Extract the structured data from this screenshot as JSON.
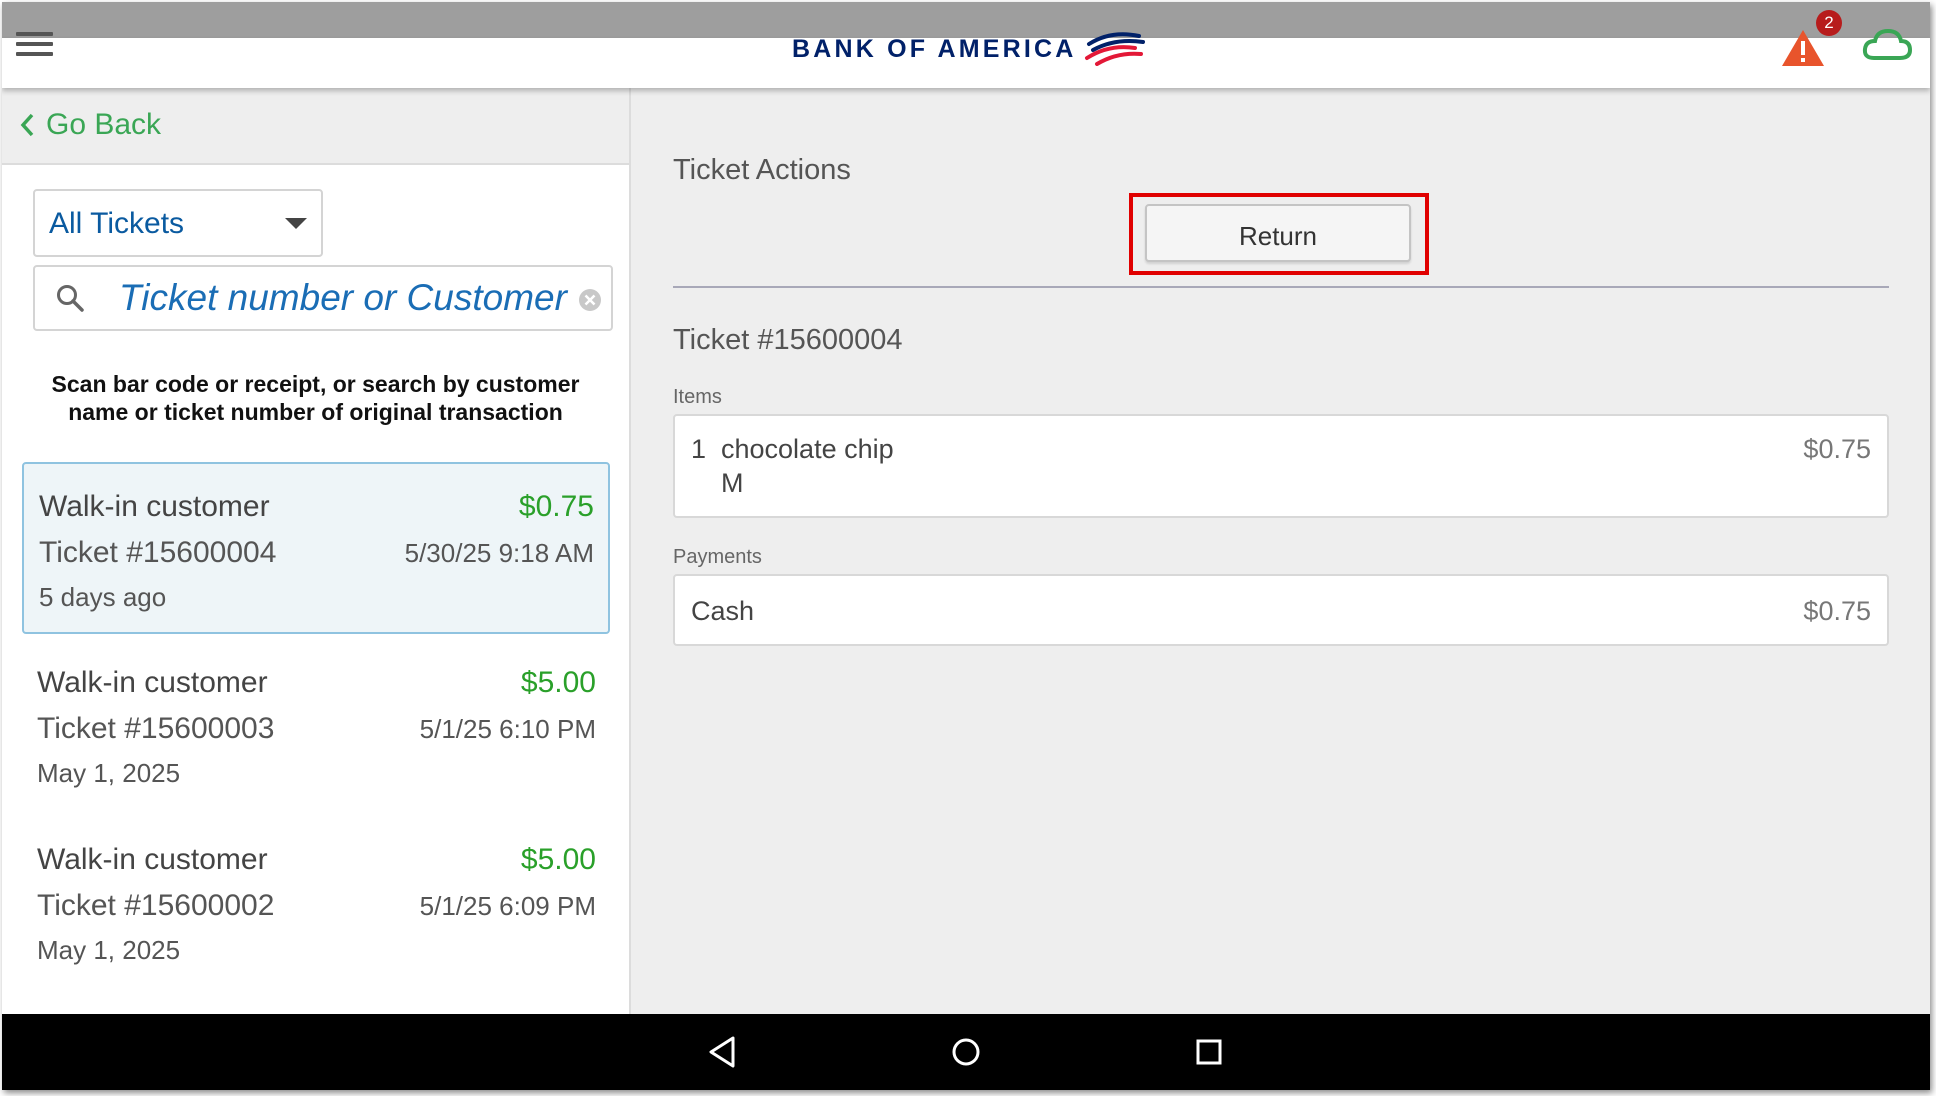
{
  "header": {
    "logo_text": "BANK OF AMERICA",
    "alert_count": "2",
    "brand_color": "#012169",
    "icons": [
      "menu-icon",
      "warning-icon",
      "cloud-icon"
    ]
  },
  "sidebar": {
    "go_back": "Go Back",
    "filter": "All Tickets",
    "search_placeholder": "Ticket number or Customer",
    "hint": "Scan bar code or receipt, or search by customer name or ticket number of original transaction",
    "tickets": [
      {
        "customer": "Walk-in customer",
        "amount": "$0.75",
        "number": "Ticket #15600004",
        "datetime": "5/30/25 9:18 AM",
        "age": "5 days ago",
        "selected": true
      },
      {
        "customer": "Walk-in customer",
        "amount": "$5.00",
        "number": "Ticket #15600003",
        "datetime": "5/1/25 6:10 PM",
        "age": "May 1, 2025",
        "selected": false
      },
      {
        "customer": "Walk-in customer",
        "amount": "$5.00",
        "number": "Ticket #15600002",
        "datetime": "5/1/25 6:09 PM",
        "age": "May 1, 2025",
        "selected": false
      }
    ]
  },
  "detail": {
    "actions_title": "Ticket Actions",
    "return_label": "Return",
    "ticket_title": "Ticket #15600004",
    "items_label": "Items",
    "items": [
      {
        "qty": "1",
        "name": "chocolate chip",
        "modifier": "M",
        "price": "$0.75"
      }
    ],
    "payments_label": "Payments",
    "payments": [
      {
        "method": "Cash",
        "amount": "$0.75"
      }
    ]
  },
  "navbar": {
    "icons": [
      "back-icon",
      "home-icon",
      "recents-icon"
    ]
  },
  "colors": {
    "accent_green": "#3aa655",
    "amount_green": "#2aa02a",
    "link_blue": "#0a5aa0",
    "highlight_red": "#e00000"
  }
}
